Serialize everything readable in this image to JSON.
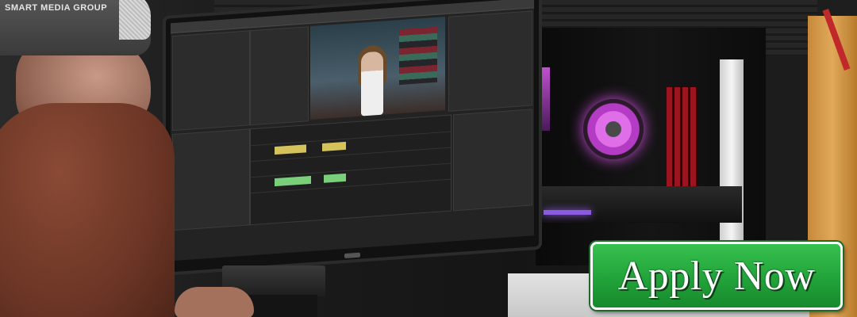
{
  "cap": {
    "text": "SMART MEDIA GROUP"
  },
  "cta": {
    "label": "Apply Now",
    "color": "#22a33a",
    "border_color": "#ffffff"
  },
  "scene": {
    "accent_fan_color": "#d050e0",
    "ram_color": "#9a1520"
  }
}
